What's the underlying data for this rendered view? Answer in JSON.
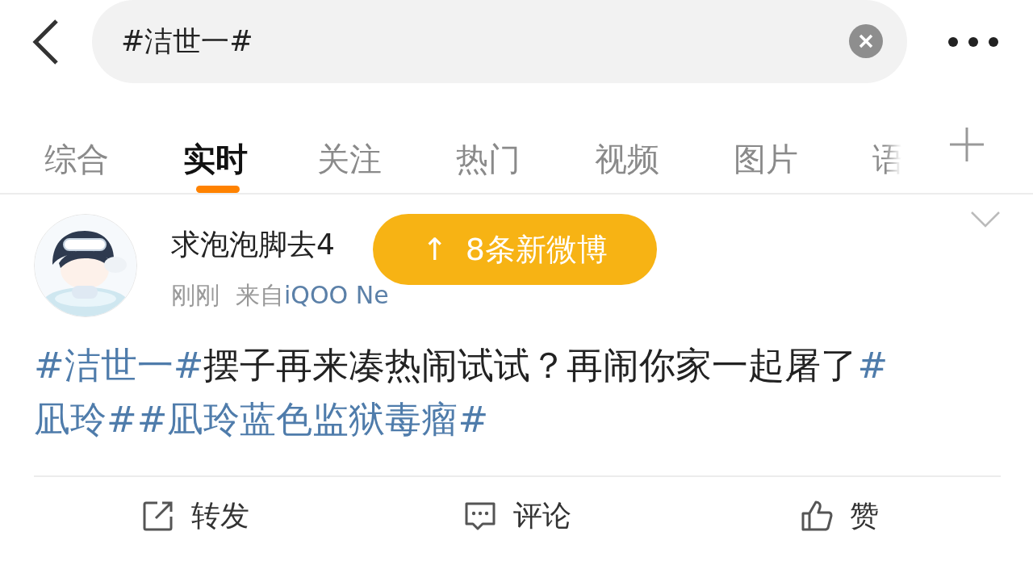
{
  "search": {
    "value": "#洁世一#"
  },
  "tabs": [
    {
      "label": "综合",
      "selected": false
    },
    {
      "label": "实时",
      "selected": true
    },
    {
      "label": "关注",
      "selected": false
    },
    {
      "label": "热门",
      "selected": false
    },
    {
      "label": "视频",
      "selected": false
    },
    {
      "label": "图片",
      "selected": false
    },
    {
      "label": "语",
      "selected": false
    }
  ],
  "post": {
    "username": "求泡泡脚去4",
    "time": "刚刚",
    "source_prefix": "来自",
    "source": "iQOO Ne",
    "body": [
      {
        "kind": "topic",
        "text": "#洁世一#"
      },
      {
        "kind": "plain",
        "text": "摆子再来凑热闹试试？再闹你家一起屠了"
      },
      {
        "kind": "topic",
        "text": "#凪玲#"
      },
      {
        "kind": "topic",
        "text": "#凪玲蓝色监狱毒瘤#"
      }
    ],
    "actions": [
      {
        "kind": "repost",
        "label": "转发"
      },
      {
        "kind": "comment",
        "label": "评论"
      },
      {
        "kind": "like",
        "label": "赞"
      }
    ]
  },
  "new_posts_pill": {
    "arrow": "↑",
    "label": "8条新微博"
  }
}
